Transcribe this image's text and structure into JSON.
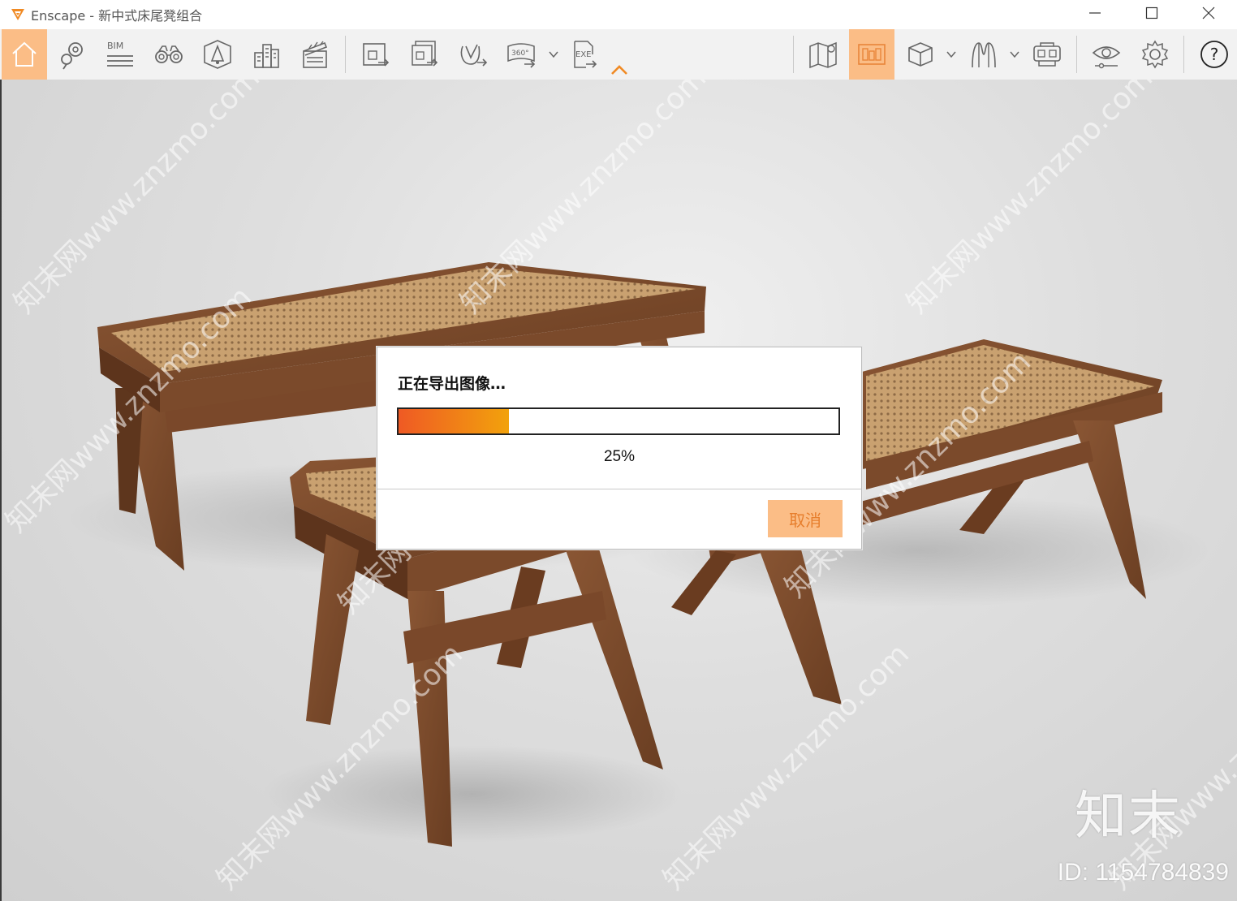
{
  "window": {
    "title": "Enscape - 新中式床尾凳组合",
    "controls": [
      "minimize-icon",
      "maximize-icon",
      "close-icon"
    ]
  },
  "toolbar": {
    "active_color": "#fbbd86",
    "left_group": [
      {
        "name": "home-icon",
        "active": true
      },
      {
        "name": "location-pins-icon"
      },
      {
        "name": "bim-icon",
        "label": "BIM"
      },
      {
        "name": "binoculars-icon"
      },
      {
        "name": "navigation-cone-icon"
      },
      {
        "name": "buildings-icon"
      },
      {
        "name": "clapperboard-icon"
      }
    ],
    "export_group": [
      {
        "name": "export-image-icon"
      },
      {
        "name": "batch-export-icon"
      },
      {
        "name": "export-video-icon"
      },
      {
        "name": "export-panorama-icon",
        "label": "360°",
        "has_dropdown": true
      },
      {
        "name": "export-exe-icon",
        "label": "EXE"
      }
    ],
    "right_group": [
      {
        "name": "map-icon"
      },
      {
        "name": "asset-library-icon",
        "active": true
      },
      {
        "name": "cube-icon",
        "has_dropdown": true
      },
      {
        "name": "material-editor-icon",
        "has_dropdown": true
      },
      {
        "name": "vr-headset-icon"
      },
      {
        "name": "eye-visual-settings-icon"
      },
      {
        "name": "gear-icon"
      },
      {
        "name": "help-icon",
        "label": "?"
      }
    ]
  },
  "dialog": {
    "title": "正在导出图像…",
    "progress": 0.25,
    "progress_text": "25%",
    "cancel_label": "取消",
    "progress_colors": [
      "#ef5a24",
      "#f2a20c"
    ]
  },
  "watermark": {
    "logo_text": "知末",
    "id_text": "ID: 1154784839",
    "diagonal_text": "知末网www.znzmo.com"
  }
}
